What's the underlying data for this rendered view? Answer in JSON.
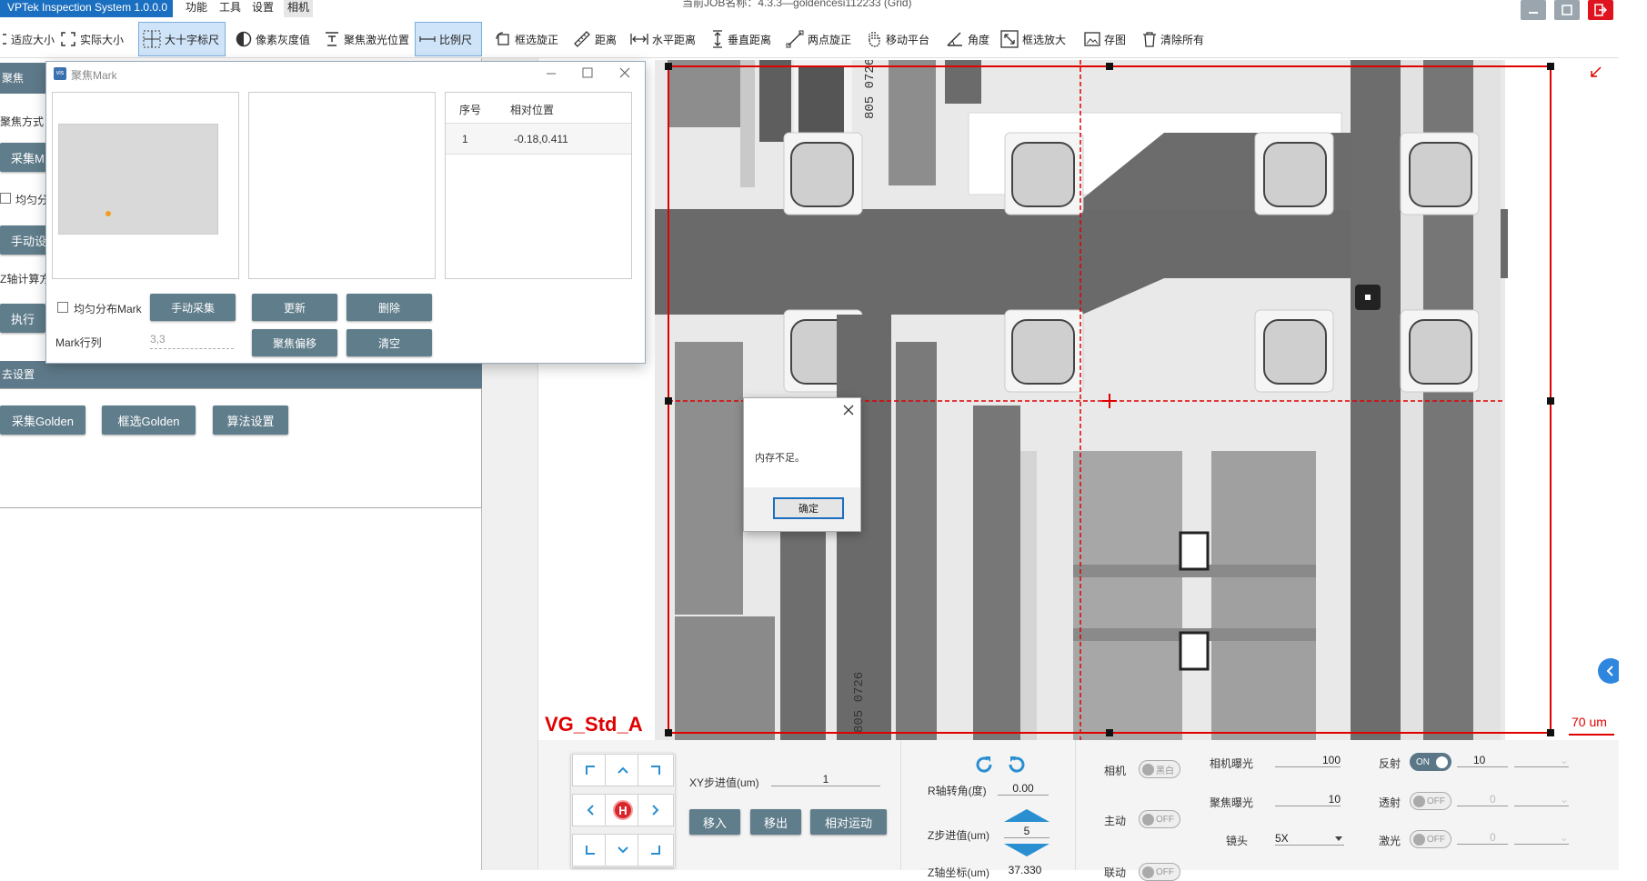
{
  "app": {
    "title": "VPTek Inspection System 1.0.0.0",
    "menus": [
      "功能",
      "工具",
      "设置",
      "相机"
    ],
    "job_title": "当前JOB名称：4.3.3—goldencesi112233 (Grid)"
  },
  "toolbar": {
    "items": [
      "适应大小",
      "实际大小",
      "大十字标尺",
      "像素灰度值",
      "聚焦激光位置",
      "比例尺",
      "框选旋正",
      "距离",
      "水平距离",
      "垂直距离",
      "两点旋正",
      "移动平台",
      "角度",
      "框选放大",
      "存图",
      "清除所有"
    ]
  },
  "left_panel": {
    "section1_title": "聚焦",
    "focus_method_label": "聚焦方式",
    "collect_mark_button": "采集M",
    "uniform_checkbox_label": "均匀分",
    "manual_button": "手动设",
    "z_calc_label": "Z轴计算方",
    "execute_button": "执行",
    "section2_title": "去设置",
    "collect_golden_button": "采集Golden",
    "select_golden_button": "框选Golden",
    "algorithm_button": "算法设置"
  },
  "mark_dialog": {
    "title": "聚焦Mark",
    "table_headers": [
      "序号",
      "相对位置"
    ],
    "table_rows": [
      [
        "1",
        "-0.18,0.411"
      ]
    ],
    "uniform_label": "均匀分布Mark",
    "manual_collect_button": "手动采集",
    "update_button": "更新",
    "delete_button": "删除",
    "mark_rows_label": "Mark行列",
    "mark_rows_value": "3,3",
    "focus_offset_button": "聚焦偏移",
    "clear_button": "清空"
  },
  "image_view": {
    "overlay_label": "VG_Std_A",
    "scale_label": "70 um",
    "chip_text_top": "805 0726",
    "chip_text_bottom": "805 0726"
  },
  "alert": {
    "message": "内存不足。",
    "ok_button": "确定"
  },
  "bottom": {
    "xy_step_label": "XY步进值(um)",
    "xy_step_value": "1",
    "move_in_button": "移入",
    "move_out_button": "移出",
    "relative_move_button": "相对运动",
    "r_angle_label": "R轴转角(度)",
    "r_angle_value": "0.00",
    "z_step_label": "Z步进值(um)",
    "z_step_value": "5",
    "z_coord_label": "Z轴坐标(um)",
    "z_coord_value": "37.330",
    "camera_label": "相机",
    "camera_toggle": "黑白",
    "active_label": "主动",
    "active_toggle": "OFF",
    "link_label": "联动",
    "link_toggle": "OFF",
    "cam_exposure_label": "相机曝光",
    "cam_exposure_value": "100",
    "focus_exposure_label": "聚焦曝光",
    "focus_exposure_value": "10",
    "lens_label": "镜头",
    "lens_value": "5X",
    "reflect_label": "反射",
    "reflect_toggle": "ON",
    "reflect_value": "10",
    "transmit_label": "透射",
    "transmit_toggle": "OFF",
    "transmit_value": "0",
    "laser_label": "激光",
    "laser_toggle": "OFF",
    "laser_value": "0"
  },
  "colors": {
    "accent": "#1b6fc0",
    "button": "#607d8b",
    "overlay_red": "#e00000"
  }
}
